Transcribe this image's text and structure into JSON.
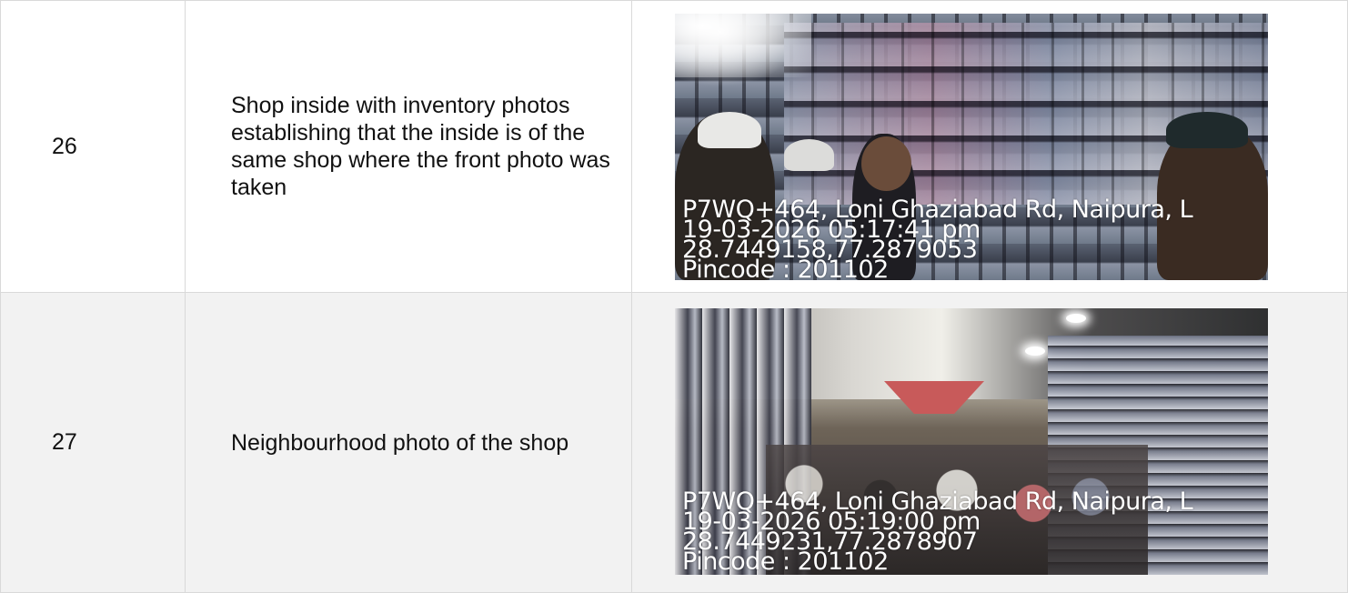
{
  "rows": [
    {
      "number": "26",
      "description": "Shop inside with inventory photos establishing that the inside is of the same shop where the front photo was taken",
      "photo": {
        "address": "P7WQ+464, Loni Ghaziabad Rd, Naipura, L",
        "datetime": "19-03-2026 05:17:41 pm",
        "coordinates": "28.7449158,77.2879053",
        "pincode": "Pincode : 201102"
      }
    },
    {
      "number": "27",
      "description": "Neighbourhood photo of the shop",
      "photo": {
        "address": "P7WQ+464, Loni Ghaziabad Rd, Naipura, L",
        "datetime": "19-03-2026 05:19:00 pm",
        "coordinates": "28.7449231,77.2878907",
        "pincode": "Pincode : 201102"
      }
    }
  ],
  "colors": {
    "border": "#d9d9d9",
    "row_alt_background": "#f2f2f2",
    "stamp_text": "#ffffff"
  }
}
